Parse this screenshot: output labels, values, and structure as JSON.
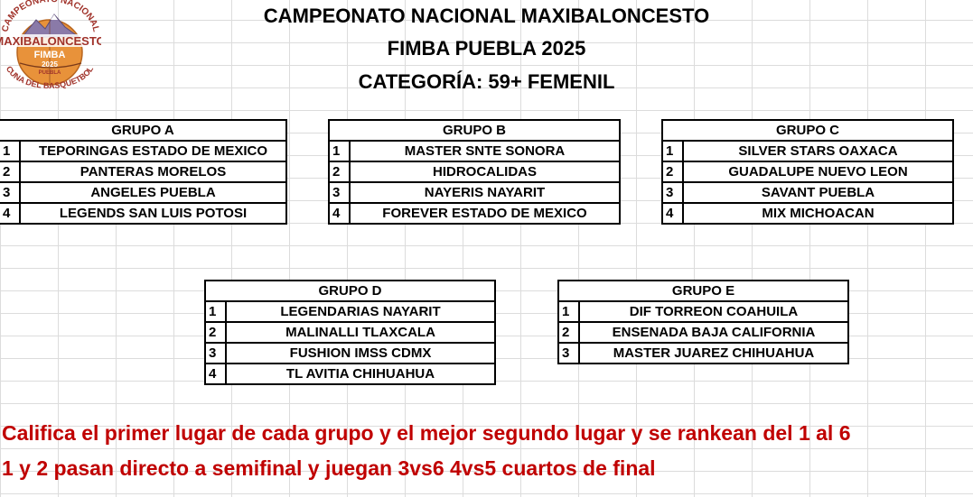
{
  "logo": {
    "arc_top": "CAMPEONATO NACIONAL",
    "main": "MAXIBALONCESTO",
    "fimba": "FIMBA",
    "year": "2025",
    "city": "PUEBLA",
    "arc_bottom": "CUNA DEL BASQUETBOL",
    "colors": {
      "orange": "#e8923a",
      "text": "#a0322a",
      "mountain": "#7a6a9a"
    }
  },
  "header": {
    "line1": "CAMPEONATO NACIONAL MAXIBALONCESTO",
    "line2": "FIMBA PUEBLA 2025",
    "line3": "CATEGORÍA:  59+ FEMENIL"
  },
  "groups": [
    {
      "title": "GRUPO A",
      "teams": [
        {
          "num": "1",
          "name": "TEPORINGAS ESTADO DE MEXICO"
        },
        {
          "num": "2",
          "name": "PANTERAS MORELOS"
        },
        {
          "num": "3",
          "name": "ANGELES PUEBLA"
        },
        {
          "num": "4",
          "name": "LEGENDS SAN LUIS POTOSI"
        }
      ]
    },
    {
      "title": "GRUPO B",
      "teams": [
        {
          "num": "1",
          "name": "MASTER SNTE SONORA"
        },
        {
          "num": "2",
          "name": "HIDROCALIDAS"
        },
        {
          "num": "3",
          "name": "NAYERIS NAYARIT"
        },
        {
          "num": "4",
          "name": "FOREVER ESTADO DE MEXICO"
        }
      ]
    },
    {
      "title": "GRUPO C",
      "teams": [
        {
          "num": "1",
          "name": "SILVER STARS OAXACA"
        },
        {
          "num": "2",
          "name": "GUADALUPE NUEVO LEON"
        },
        {
          "num": "3",
          "name": "SAVANT PUEBLA"
        },
        {
          "num": "4",
          "name": "MIX MICHOACAN"
        }
      ]
    },
    {
      "title": "GRUPO D",
      "teams": [
        {
          "num": "1",
          "name": "LEGENDARIAS NAYARIT"
        },
        {
          "num": "2",
          "name": "MALINALLI TLAXCALA"
        },
        {
          "num": "3",
          "name": "FUSHION IMSS CDMX"
        },
        {
          "num": "4",
          "name": "TL AVITIA CHIHUAHUA"
        }
      ]
    },
    {
      "title": "GRUPO E",
      "teams": [
        {
          "num": "1",
          "name": "DIF TORREON COAHUILA"
        },
        {
          "num": "2",
          "name": "ENSENADA BAJA CALIFORNIA"
        },
        {
          "num": "3",
          "name": "MASTER JUAREZ CHIHUAHUA"
        }
      ]
    }
  ],
  "notes": {
    "line1": "Califica el primer lugar de cada grupo y el mejor segundo lugar y se rankean del 1 al 6",
    "line2": "1 y 2 pasan directo a semifinal y juegan 3vs6 4vs5 cuartos de final",
    "color": "#c00000"
  }
}
